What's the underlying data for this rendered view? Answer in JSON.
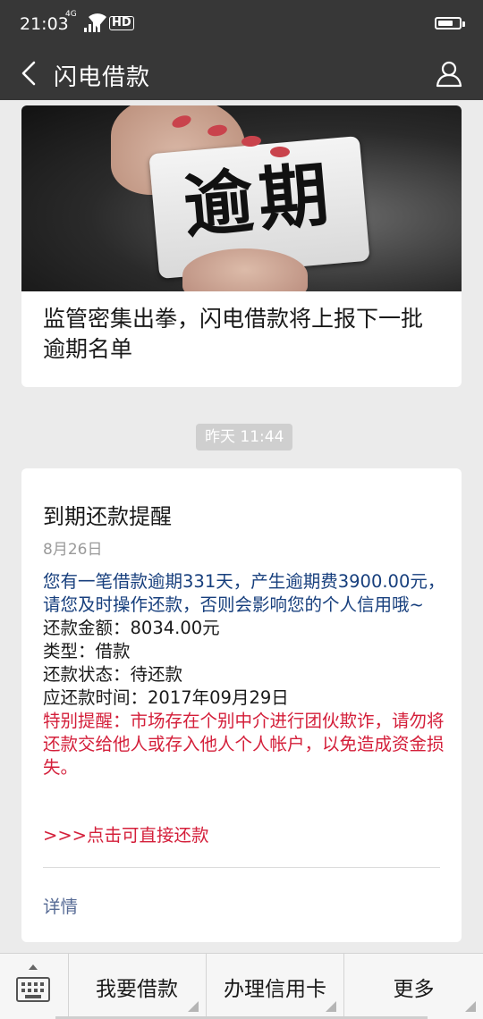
{
  "statusbar": {
    "time": "21:03",
    "network": "4G",
    "hd": "HD",
    "icons": [
      "signal-icon",
      "wifi-icon",
      "hd-icon",
      "battery-icon"
    ]
  },
  "navbar": {
    "title": "闪电借款",
    "back_icon": "back-arrow-icon",
    "profile_icon": "user-icon"
  },
  "article": {
    "image_text": "逾期",
    "headline": "监管密集出拳，闪电借款将上报下一批逾期名单"
  },
  "timestamp": "昨天 11:44",
  "notice": {
    "title": "到期还款提醒",
    "date": "8月26日",
    "intro": "您有一笔借款逾期331天，产生逾期费3900.00元，请您及时操作还款，否则会影响您的个人信用哦~",
    "amount": "还款金额：8034.00元",
    "type": "类型：借款",
    "status": "还款状态：待还款",
    "due_time": "应还款时间：2017年09月29日",
    "warning": "特别提醒：市场存在个别中介进行团伙欺诈，请勿将还款交给他人或存入他人个人帐户，以免造成资金损失。",
    "link": ">>>点击可直接还款",
    "detail": "详情",
    "colors": {
      "intro": "#173f7d",
      "warning": "#d41f3a",
      "link": "#d41f3a",
      "detail": "#576b95"
    }
  },
  "menu": {
    "keyboard_icon": "keyboard-icon",
    "items": [
      {
        "label": "我要借款"
      },
      {
        "label": "办理信用卡"
      },
      {
        "label": "更多"
      }
    ]
  }
}
